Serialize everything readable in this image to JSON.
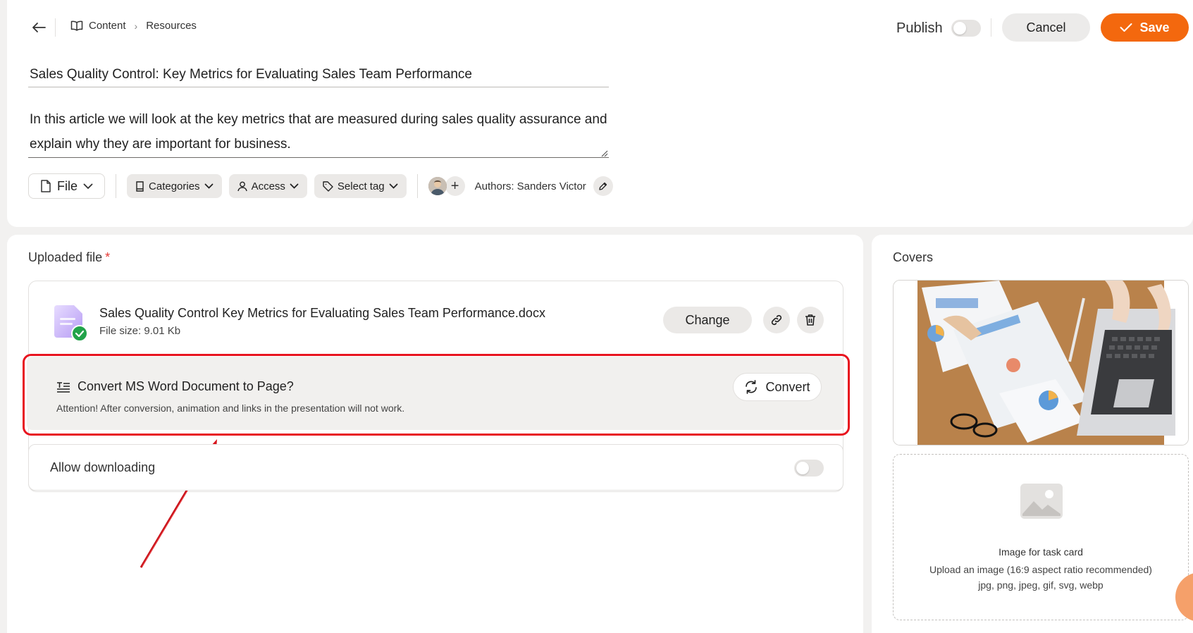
{
  "header": {
    "breadcrumb": [
      "Content",
      "Resources"
    ],
    "publish_label": "Publish",
    "publish_on": false,
    "cancel_label": "Cancel",
    "save_label": "Save"
  },
  "editor": {
    "title": "Sales Quality Control: Key Metrics for Evaluating Sales Team Performance",
    "description": "In this article we will look at the key metrics that are measured during sales quality assurance and explain why they are important for business."
  },
  "toolbar": {
    "type_label": "File",
    "categories_label": "Categories",
    "access_label": "Access",
    "tag_label": "Select tag",
    "authors_label": "Authors: Sanders Victor"
  },
  "upload_section": {
    "label": "Uploaded file",
    "required_mark": "*",
    "file_name": "Sales Quality Control Key Metrics for Evaluating Sales Team Performance.docx",
    "file_size": "File size: 9.01 Kb",
    "change_label": "Change"
  },
  "convert": {
    "title": "Convert MS Word Document to Page?",
    "note": "Attention! After conversion, animation and links in the presentation will not work.",
    "button_label": "Convert"
  },
  "download": {
    "label": "Allow downloading",
    "enabled": false
  },
  "covers": {
    "label": "Covers",
    "upload_title": "Image for task card",
    "upload_hint": "Upload an image (16:9 aspect ratio recommended)",
    "upload_formats": "jpg, png, jpeg, gif, svg, webp"
  },
  "colors": {
    "accent": "#f3680e",
    "highlight": "#e8141f",
    "success": "#22a34a"
  }
}
